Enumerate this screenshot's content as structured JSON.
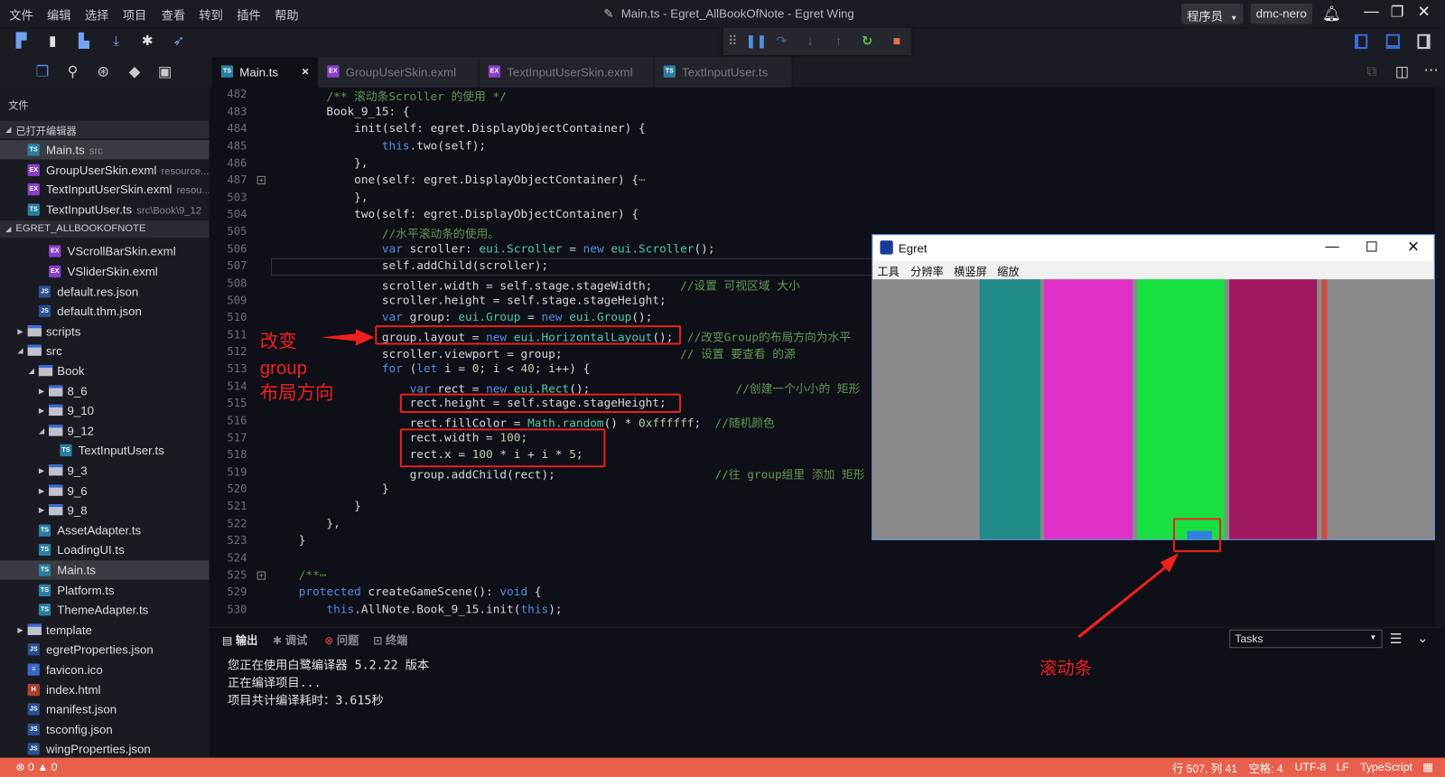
{
  "menubar": {
    "items": [
      "文件",
      "编辑",
      "选择",
      "项目",
      "查看",
      "转到",
      "插件",
      "帮助"
    ],
    "title": "Main.ts - Egret_AllBookOfNote - Egret Wing",
    "role": "程序员",
    "user": "dmc-nero"
  },
  "toolbar": {
    "icons": [
      "new-project-icon",
      "save-icon",
      "save-all-icon",
      "publish-icon",
      "debug-icon",
      "rocket-icon"
    ]
  },
  "debug": {
    "icons": [
      "drag-handle-icon",
      "pause-icon",
      "step-over-icon",
      "step-into-icon",
      "step-out-icon",
      "restart-icon",
      "stop-icon"
    ],
    "colors": {
      "pause": "#4f8fe0",
      "restart": "#5fc050",
      "stop": "#e8704c"
    }
  },
  "activity": {
    "icons": [
      "explorer-icon",
      "search-icon",
      "extensions-icon",
      "git-icon",
      "egret-icon"
    ]
  },
  "tabs": [
    {
      "label": "Main.ts",
      "icon": "ts",
      "active": true,
      "close": "×"
    },
    {
      "label": "GroupUserSkin.exml",
      "icon": "exml"
    },
    {
      "label": "TextInputUserSkin.exml",
      "icon": "exml"
    },
    {
      "label": "TextInputUser.ts",
      "icon": "ts"
    }
  ],
  "sidebar": {
    "title": "文件",
    "open_editors_header": "已打开编辑器",
    "open_editors": [
      {
        "label": "Main.ts",
        "hint": "src",
        "icon": "ts",
        "selected": true
      },
      {
        "label": "GroupUserSkin.exml",
        "hint": "resource...",
        "icon": "exml"
      },
      {
        "label": "TextInputUserSkin.exml",
        "hint": "resou...",
        "icon": "exml"
      },
      {
        "label": "TextInputUser.ts",
        "hint": "src\\Book\\9_12",
        "icon": "ts"
      }
    ],
    "project_header": "EGRET_ALLBOOKOFNOTE",
    "tree": [
      {
        "label": "VScrollBarSkin.exml",
        "icon": "exml",
        "depth": 3
      },
      {
        "label": "VSliderSkin.exml",
        "icon": "exml",
        "depth": 3
      },
      {
        "label": "default.res.json",
        "icon": "json",
        "depth": 2
      },
      {
        "label": "default.thm.json",
        "icon": "json",
        "depth": 2
      },
      {
        "label": "scripts",
        "icon": "folder",
        "depth": 1,
        "state": "collapsed"
      },
      {
        "label": "src",
        "icon": "folder",
        "depth": 1,
        "state": "expanded"
      },
      {
        "label": "Book",
        "icon": "folder",
        "depth": 2,
        "state": "expanded"
      },
      {
        "label": "8_6",
        "icon": "folder",
        "depth": 3,
        "state": "collapsed"
      },
      {
        "label": "9_10",
        "icon": "folder",
        "depth": 3,
        "state": "collapsed"
      },
      {
        "label": "9_12",
        "icon": "folder",
        "depth": 3,
        "state": "expanded"
      },
      {
        "label": "TextInputUser.ts",
        "icon": "ts",
        "depth": 4
      },
      {
        "label": "9_3",
        "icon": "folder",
        "depth": 3,
        "state": "collapsed"
      },
      {
        "label": "9_6",
        "icon": "folder",
        "depth": 3,
        "state": "collapsed"
      },
      {
        "label": "9_8",
        "icon": "folder",
        "depth": 3,
        "state": "collapsed"
      },
      {
        "label": "AssetAdapter.ts",
        "icon": "ts",
        "depth": 2
      },
      {
        "label": "LoadingUI.ts",
        "icon": "ts",
        "depth": 2
      },
      {
        "label": "Main.ts",
        "icon": "ts",
        "depth": 2,
        "selected": true
      },
      {
        "label": "Platform.ts",
        "icon": "ts",
        "depth": 2
      },
      {
        "label": "ThemeAdapter.ts",
        "icon": "ts",
        "depth": 2
      },
      {
        "label": "template",
        "icon": "folder",
        "depth": 1,
        "state": "collapsed"
      },
      {
        "label": "egretProperties.json",
        "icon": "json",
        "depth": 1
      },
      {
        "label": "favicon.ico",
        "icon": "ico",
        "depth": 1
      },
      {
        "label": "index.html",
        "icon": "html",
        "depth": 1
      },
      {
        "label": "manifest.json",
        "icon": "json",
        "depth": 1
      },
      {
        "label": "tsconfig.json",
        "icon": "json",
        "depth": 1
      },
      {
        "label": "wingProperties.json",
        "icon": "json",
        "depth": 1
      }
    ]
  },
  "editor": {
    "current_line": 507,
    "lines": [
      {
        "n": 482,
        "tokens": [
          [
            "        ",
            ""
          ],
          [
            "/** 滚动条Scroller 的使用 */",
            "c"
          ]
        ]
      },
      {
        "n": 483,
        "tokens": [
          [
            "        Book_9_15: {",
            ""
          ]
        ]
      },
      {
        "n": 484,
        "tokens": [
          [
            "            init(self: egret.DisplayObjectContainer) {",
            ""
          ]
        ]
      },
      {
        "n": 485,
        "tokens": [
          [
            "                ",
            ""
          ],
          [
            "this",
            "k"
          ],
          [
            ".two(self);",
            ""
          ]
        ]
      },
      {
        "n": 486,
        "tokens": [
          [
            "            },",
            ""
          ]
        ]
      },
      {
        "n": 487,
        "fold": true,
        "tokens": [
          [
            "            one(self: egret.DisplayObjectContainer) {",
            ""
          ],
          [
            "⋯",
            "c"
          ]
        ]
      },
      {
        "n": 503,
        "tokens": [
          [
            "            },",
            ""
          ]
        ]
      },
      {
        "n": 504,
        "tokens": [
          [
            "            two(self: egret.DisplayObjectContainer) {",
            ""
          ]
        ]
      },
      {
        "n": 505,
        "tokens": [
          [
            "                ",
            ""
          ],
          [
            "//水平滚动条的使用。",
            "c"
          ]
        ]
      },
      {
        "n": 506,
        "tokens": [
          [
            "                ",
            ""
          ],
          [
            "var",
            "k"
          ],
          [
            " scroller: ",
            ""
          ],
          [
            "eui.Scroller",
            "t"
          ],
          [
            " = ",
            ""
          ],
          [
            "new",
            "k"
          ],
          [
            " ",
            ""
          ],
          [
            "eui.Scroller",
            "t"
          ],
          [
            "();",
            ""
          ]
        ]
      },
      {
        "n": 507,
        "tokens": [
          [
            "                self.addChild(scroller);",
            ""
          ]
        ]
      },
      {
        "n": 508,
        "tokens": [
          [
            "                scroller.width = self.stage.stageWidth;    ",
            ""
          ],
          [
            "//设置 可视区域 大小",
            "c"
          ]
        ]
      },
      {
        "n": 509,
        "tokens": [
          [
            "                scroller.height = self.stage.stageHeight;",
            ""
          ]
        ]
      },
      {
        "n": 510,
        "tokens": [
          [
            "                ",
            ""
          ],
          [
            "var",
            "k"
          ],
          [
            " group: ",
            ""
          ],
          [
            "eui.Group",
            "t"
          ],
          [
            " = ",
            ""
          ],
          [
            "new",
            "k"
          ],
          [
            " ",
            ""
          ],
          [
            "eui.Group",
            "t"
          ],
          [
            "();",
            ""
          ]
        ]
      },
      {
        "n": 511,
        "tokens": [
          [
            "                group.layout = ",
            ""
          ],
          [
            "new",
            "k"
          ],
          [
            " ",
            ""
          ],
          [
            "eui.HorizontalLayout",
            "t"
          ],
          [
            "();  ",
            ""
          ],
          [
            "//改变Group的布局方向为水平",
            "c"
          ]
        ]
      },
      {
        "n": 512,
        "tokens": [
          [
            "                scroller.viewport = group;                 ",
            ""
          ],
          [
            "// 设置 要查看 的源",
            "c"
          ]
        ]
      },
      {
        "n": 513,
        "tokens": [
          [
            "                ",
            ""
          ],
          [
            "for",
            "k"
          ],
          [
            " (",
            ""
          ],
          [
            "let",
            "k"
          ],
          [
            " i = ",
            ""
          ],
          [
            "0",
            "n"
          ],
          [
            "; i < ",
            ""
          ],
          [
            "40",
            "n"
          ],
          [
            "; i++) {",
            ""
          ]
        ]
      },
      {
        "n": 514,
        "tokens": [
          [
            "                    ",
            ""
          ],
          [
            "var",
            "k"
          ],
          [
            " rect = ",
            ""
          ],
          [
            "new",
            "k"
          ],
          [
            " ",
            ""
          ],
          [
            "eui.Rect",
            "t"
          ],
          [
            "();                     ",
            ""
          ],
          [
            "//创建一个小小的 矩形",
            "c"
          ]
        ]
      },
      {
        "n": 515,
        "tokens": [
          [
            "                    rect.height = self.stage.stageHeight;",
            ""
          ]
        ]
      },
      {
        "n": 516,
        "tokens": [
          [
            "                    rect.fillColor = ",
            ""
          ],
          [
            "Math.random",
            "t"
          ],
          [
            "() * ",
            ""
          ],
          [
            "0xffffff",
            "n"
          ],
          [
            ";  ",
            ""
          ],
          [
            "//随机颜色",
            "c"
          ]
        ]
      },
      {
        "n": 517,
        "tokens": [
          [
            "                    rect.width = ",
            ""
          ],
          [
            "100",
            "n"
          ],
          [
            ";",
            ""
          ]
        ]
      },
      {
        "n": 518,
        "tokens": [
          [
            "                    rect.x = ",
            ""
          ],
          [
            "100",
            "n"
          ],
          [
            " * i + i * ",
            ""
          ],
          [
            "5",
            "n"
          ],
          [
            ";",
            ""
          ]
        ]
      },
      {
        "n": 519,
        "tokens": [
          [
            "                    group.addChild(rect);                       ",
            ""
          ],
          [
            "//往 group组里 添加 矩形",
            "c"
          ]
        ]
      },
      {
        "n": 520,
        "tokens": [
          [
            "                }",
            ""
          ]
        ]
      },
      {
        "n": 521,
        "tokens": [
          [
            "            }",
            ""
          ]
        ]
      },
      {
        "n": 522,
        "tokens": [
          [
            "        },",
            ""
          ]
        ]
      },
      {
        "n": 523,
        "tokens": [
          [
            "    }",
            ""
          ]
        ]
      },
      {
        "n": 524,
        "tokens": []
      },
      {
        "n": 525,
        "fold": true,
        "tokens": [
          [
            "    ",
            ""
          ],
          [
            "/**⋯",
            "c"
          ]
        ]
      },
      {
        "n": 529,
        "tokens": [
          [
            "    ",
            ""
          ],
          [
            "protected",
            "k"
          ],
          [
            " createGameScene(): ",
            ""
          ],
          [
            "void",
            "k"
          ],
          [
            " {",
            ""
          ]
        ]
      },
      {
        "n": 530,
        "tokens": [
          [
            "        ",
            ""
          ],
          [
            "this",
            "k"
          ],
          [
            ".AllNote.Book_9_15.init(",
            ""
          ],
          [
            "this",
            "k"
          ],
          [
            ");",
            ""
          ]
        ]
      }
    ]
  },
  "annotations": {
    "left_label": [
      "改变",
      "group",
      "布局方向"
    ],
    "scrollbar_label": "滚动条",
    "color": "#f02020"
  },
  "egret_window": {
    "title": "Egret",
    "menu": [
      "工具",
      "分辨率",
      "横竖屏",
      "缩放"
    ],
    "background": "#8a8a8a",
    "bars": [
      "#208a88",
      "#e030c8",
      "#18e040",
      "#a01860",
      "#d04a40"
    ],
    "scrollbar_color": "#2f7fe0"
  },
  "panel": {
    "tabs": [
      "输出",
      "调试",
      "问题",
      "终端"
    ],
    "output": [
      "您正在使用白鹭编译器 5.2.22 版本",
      "正在编译项目...",
      "项目共计编译耗时：3.615秒"
    ],
    "task_select": "Tasks"
  },
  "status": {
    "errors": "0",
    "warnings": "0",
    "position": "行 507, 列 41",
    "spaces": "空格: 4",
    "encoding": "UTF-8",
    "eol": "LF",
    "language": "TypeScript",
    "color": "#e8604c"
  }
}
